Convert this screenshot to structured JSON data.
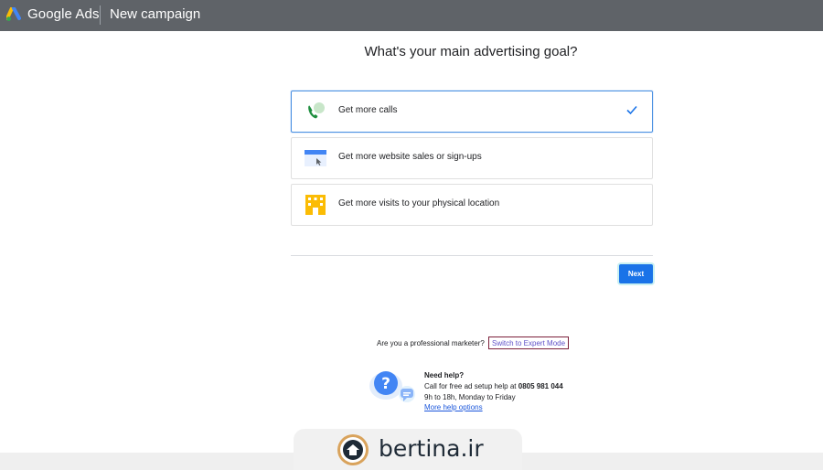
{
  "header": {
    "brand": "Google Ads",
    "section": "New campaign",
    "colors": {
      "bar": "#5f6368",
      "text": "#ffffff"
    }
  },
  "main": {
    "heading": "What's your main advertising goal?",
    "goals": [
      {
        "label": "Get more calls",
        "icon": "phone-call-icon",
        "selected": true
      },
      {
        "label": "Get more website sales or sign-ups",
        "icon": "website-icon",
        "selected": false
      },
      {
        "label": "Get more visits to your physical location",
        "icon": "storefront-icon",
        "selected": false
      }
    ],
    "next_label": "Next"
  },
  "expert": {
    "question": "Are you a professional marketer?",
    "link": "Switch to Expert Mode"
  },
  "help": {
    "title": "Need help?",
    "line1_prefix": "Call for free ad setup help at",
    "phone": "0805 981 044",
    "hours": "9h to 18h, Monday to Friday",
    "more": "More help options"
  },
  "watermark": {
    "text": "bertina.ir"
  },
  "colors": {
    "accent": "#1a73e8",
    "selected_border": "#4a90e2",
    "link": "#5f51c8"
  }
}
